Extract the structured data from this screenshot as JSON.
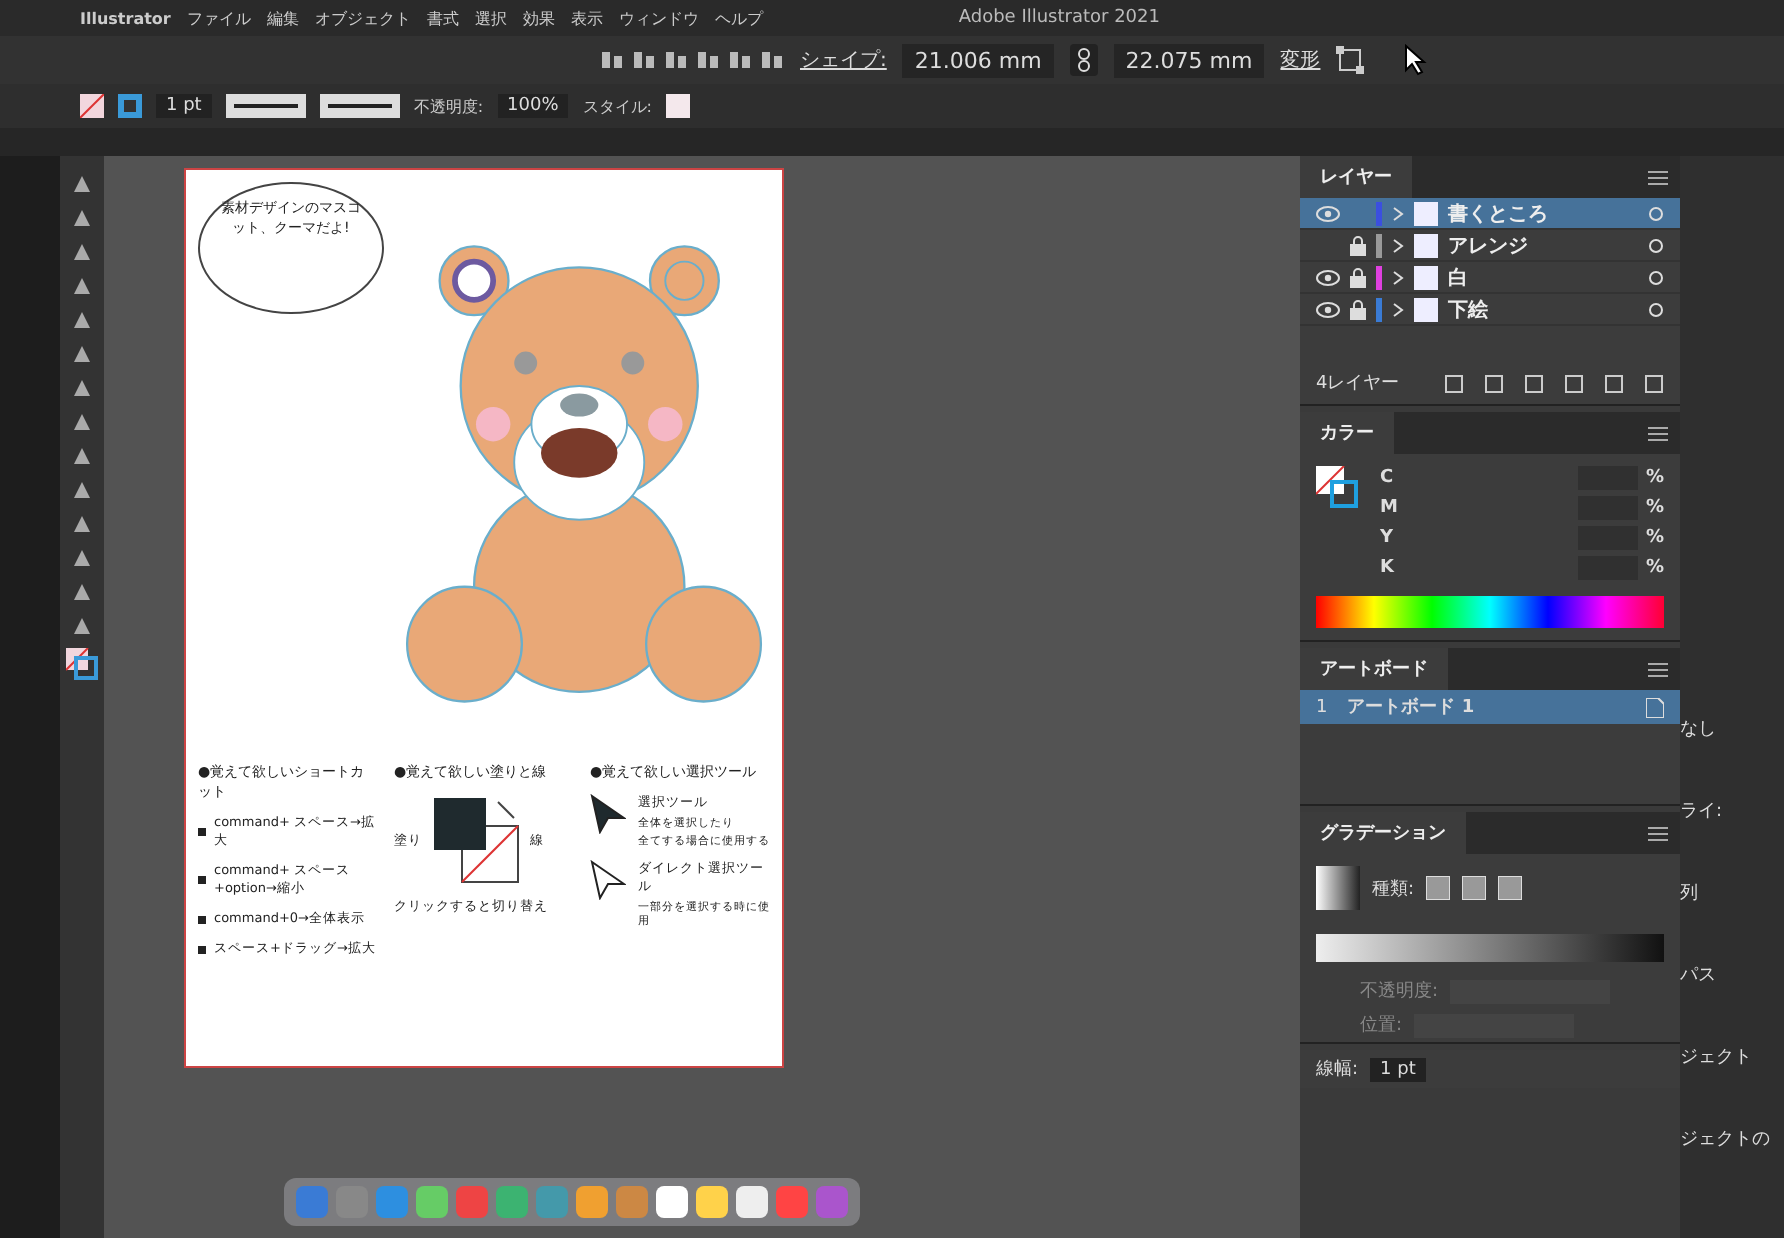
{
  "menu_bar": {
    "items": [
      "Illustrator",
      "ファイル",
      "編集",
      "オブジェクト",
      "書式",
      "選択",
      "効果",
      "表示",
      "ウィンドウ",
      "ヘルプ"
    ],
    "title": "Adobe Illustrator 2021"
  },
  "control_bar": {
    "label": "シェイプ:",
    "width": "21.006 mm",
    "height": "22.075 mm",
    "transform": "変形"
  },
  "property_bar": {
    "stroke_weight": "1 pt",
    "opacity_label": "不透明度:",
    "opacity": "100%",
    "style_label": "スタイル:"
  },
  "artboard": {
    "speech_bubble": "素材デザインのマスコット、クーマだよ!",
    "sections": [
      {
        "kind": "list",
        "heading": "●覚えて欲しいショートカット",
        "items": [
          "command+ スペース→拡大",
          "command+ スペース+option→縮小",
          "command+0→全体表示",
          "スペース+ドラッグ→拡大"
        ]
      },
      {
        "kind": "swatch",
        "heading": "●覚えて欲しい塗りと線",
        "fill_label": "塗り",
        "stroke_label": "線",
        "caption": "クリックすると切り替え"
      },
      {
        "kind": "tools",
        "heading": "●覚えて欲しい選択ツール",
        "tools": [
          {
            "kind": "solid",
            "name": "選択ツール",
            "notes": [
              "全体を選択したり",
              "全てする場合に使用する"
            ]
          },
          {
            "kind": "hollow",
            "name": "ダイレクト選択ツール",
            "notes": [
              "一部分を選択する時に使用"
            ]
          }
        ]
      }
    ]
  },
  "layers_panel": {
    "title": "レイヤー",
    "layers": [
      {
        "name": "書くところ",
        "visible": true,
        "locked": false,
        "selected": true,
        "color": "#3b4fe0"
      },
      {
        "name": "アレンジ",
        "visible": false,
        "locked": true,
        "selected": false,
        "color": "#9a9a9a"
      },
      {
        "name": "白",
        "visible": true,
        "locked": true,
        "selected": false,
        "color": "#e040e0"
      },
      {
        "name": "下絵",
        "visible": true,
        "locked": true,
        "selected": false,
        "color": "#3a7bd5"
      }
    ],
    "count": "4レイヤー"
  },
  "color_panel": {
    "title": "カラー",
    "channels": [
      {
        "label": "C",
        "unit": "%"
      },
      {
        "label": "M",
        "unit": "%"
      },
      {
        "label": "Y",
        "unit": "%"
      },
      {
        "label": "K",
        "unit": "%"
      }
    ]
  },
  "artboards_panel": {
    "title": "アートボード",
    "artboards": [
      {
        "number": "1",
        "name": "アートボード 1",
        "selected": true
      }
    ]
  },
  "gradient_panel": {
    "title": "グラデーション",
    "type_label": "種類:",
    "opacity_label": "不透明度:",
    "location_label": "位置:"
  },
  "stroke_panel": {
    "weight_label": "線幅:",
    "weight": "1 pt"
  },
  "side_column": {
    "texts": [
      "なし",
      "ライ:",
      "列",
      "パス",
      "ジェクト",
      "ジェクトの"
    ]
  }
}
